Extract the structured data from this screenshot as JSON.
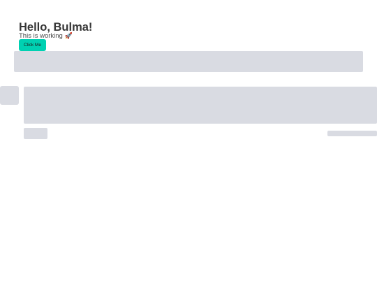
{
  "hero": {
    "title": "Hello, Bulma!",
    "subtitle": "This is working",
    "subtitle_emoji": "🚀"
  },
  "actions": {
    "primary_label": "Click Me"
  },
  "colors": {
    "primary": "#00d1b2",
    "skeleton": "#d9dbe2",
    "text": "#363636"
  }
}
